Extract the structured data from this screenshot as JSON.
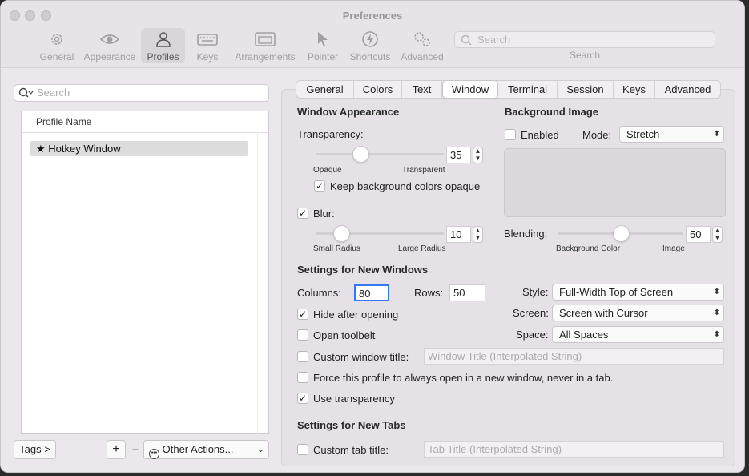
{
  "window": {
    "title": "Preferences"
  },
  "toolbar": {
    "items": [
      {
        "label": "General",
        "icon": "gear-icon"
      },
      {
        "label": "Appearance",
        "icon": "eye-icon"
      },
      {
        "label": "Profiles",
        "icon": "person-icon",
        "active": true
      },
      {
        "label": "Keys",
        "icon": "keyboard-icon"
      },
      {
        "label": "Arrangements",
        "icon": "windows-icon"
      },
      {
        "label": "Pointer",
        "icon": "pointer-icon"
      },
      {
        "label": "Shortcuts",
        "icon": "bolt-icon"
      },
      {
        "label": "Advanced",
        "icon": "gears-icon"
      }
    ],
    "search_placeholder": "Search",
    "search_caption": "Search"
  },
  "sidebar": {
    "search_placeholder": "Search",
    "column_header": "Profile Name",
    "profiles": [
      {
        "name": "Hotkey Window",
        "starred": true
      }
    ],
    "tags_label": "Tags >",
    "add_label": "+",
    "remove_label": "−",
    "other_actions_label": "Other Actions..."
  },
  "tabs": {
    "items": [
      "General",
      "Colors",
      "Text",
      "Window",
      "Terminal",
      "Session",
      "Keys",
      "Advanced"
    ],
    "active": "Window"
  },
  "window_appearance": {
    "heading": "Window Appearance",
    "transparency_label": "Transparency:",
    "transparency_value": "35",
    "transparency_fraction": 0.35,
    "transparency_min_label": "Opaque",
    "transparency_max_label": "Transparent",
    "keep_bg_opaque_label": "Keep background colors opaque",
    "keep_bg_opaque_checked": true,
    "blur_label": "Blur:",
    "blur_checked": true,
    "blur_value": "10",
    "blur_fraction": 0.2,
    "blur_min_label": "Small Radius",
    "blur_max_label": "Large Radius"
  },
  "background_image": {
    "heading": "Background Image",
    "enabled_label": "Enabled",
    "enabled_checked": false,
    "mode_label": "Mode:",
    "mode_value": "Stretch",
    "blending_label": "Blending:",
    "blending_value": "50",
    "blending_fraction": 0.5,
    "blending_min_label": "Background Color",
    "blending_max_label": "Image"
  },
  "new_windows": {
    "heading": "Settings for New Windows",
    "columns_label": "Columns:",
    "columns_value": "80",
    "rows_label": "Rows:",
    "rows_value": "50",
    "style_label": "Style:",
    "style_value": "Full-Width Top of Screen",
    "screen_label": "Screen:",
    "screen_value": "Screen with Cursor",
    "space_label": "Space:",
    "space_value": "All Spaces",
    "hide_after_opening_label": "Hide after opening",
    "hide_after_opening_checked": true,
    "open_toolbelt_label": "Open toolbelt",
    "open_toolbelt_checked": false,
    "custom_title_label": "Custom window title:",
    "custom_title_checked": false,
    "custom_title_placeholder": "Window Title (Interpolated String)",
    "force_new_window_label": "Force this profile to always open in a new window, never in a tab.",
    "force_new_window_checked": false,
    "use_transparency_label": "Use transparency",
    "use_transparency_checked": true
  },
  "new_tabs": {
    "heading": "Settings for New Tabs",
    "custom_tab_title_label": "Custom tab title:",
    "custom_tab_title_checked": false,
    "custom_tab_title_placeholder": "Tab Title (Interpolated String)"
  },
  "colors": {
    "accent": "#3478f6",
    "window_bg": "#ebe7ec"
  }
}
